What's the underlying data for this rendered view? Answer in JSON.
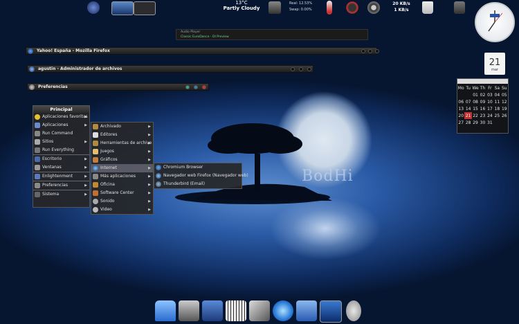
{
  "top_panel": {
    "weather_temp": "13°C",
    "weather_condition": "Partly Cloudy",
    "mem_real": "Real: 12.53%",
    "mem_swap": "Swap: 0.00%",
    "net_down": "20 KB/s",
    "net_up": "1 KB/s"
  },
  "media_player": {
    "line1": "Audio Player",
    "line2": "Classic EuroDance - DI Preview"
  },
  "windows": [
    {
      "title": "Yahoo! España - Mozilla Firefox"
    },
    {
      "title": "agustin - Administrador de archivos"
    },
    {
      "title": "Preferencias"
    }
  ],
  "calendar": {
    "icon_day": "21",
    "icon_month": "mar",
    "headers": [
      "Mo",
      "Tu",
      "We",
      "Th",
      "Fr",
      "Sa",
      "Su"
    ],
    "rows": [
      [
        "",
        "",
        "",
        "01",
        "02",
        "03",
        "04",
        "05"
      ],
      [
        "06",
        "07",
        "08",
        "09",
        "10",
        "11",
        "12"
      ],
      [
        "13",
        "14",
        "15",
        "16",
        "17",
        "18",
        "19"
      ],
      [
        "20",
        "21",
        "22",
        "23",
        "24",
        "25",
        "26"
      ],
      [
        "27",
        "28",
        "29",
        "30",
        "31",
        "",
        ""
      ]
    ],
    "today": "21"
  },
  "menu_main": {
    "title": "Principal",
    "items": [
      {
        "label": "Aplicaciones favoritas"
      },
      {
        "label": "Aplicaciones"
      },
      {
        "label": "Run Command"
      },
      {
        "label": "Sitios"
      },
      {
        "label": "Run Everything"
      },
      {
        "label": "Escritorio"
      },
      {
        "label": "Ventanas"
      },
      {
        "label": "Enlightenment"
      },
      {
        "label": "Preferencias"
      },
      {
        "label": "Sistema"
      }
    ]
  },
  "menu_apps": {
    "items": [
      {
        "label": "Archivado"
      },
      {
        "label": "Editores"
      },
      {
        "label": "Herramientas de archivo"
      },
      {
        "label": "Juegos"
      },
      {
        "label": "Gráficos"
      },
      {
        "label": "Internet"
      },
      {
        "label": "Más aplicaciones"
      },
      {
        "label": "Oficina"
      },
      {
        "label": "Software Center"
      },
      {
        "label": "Sonido"
      },
      {
        "label": "Video"
      }
    ]
  },
  "menu_internet": {
    "items": [
      {
        "label": "Chromium Browser"
      },
      {
        "label": "Navegador web Firefox (Navegador web)"
      },
      {
        "label": "Thunderbird (Email)"
      }
    ]
  },
  "wallpaper_brand": "BodHi",
  "dock": {
    "icons": [
      "home-folder-icon",
      "system-tools-icon",
      "development-icon",
      "music-keyboard-icon",
      "graphics-icon",
      "web-browser-icon",
      "accessories-icon",
      "terminal-icon",
      "lock-screen-icon"
    ]
  }
}
